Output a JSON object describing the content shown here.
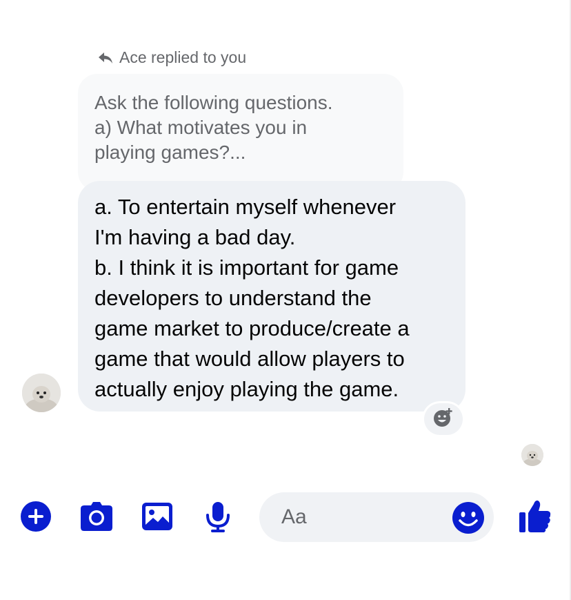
{
  "thread": {
    "reply_label": "Ace replied to you",
    "quoted_message": "Ask the following questions.\na) What motivates you in\nplaying games?...",
    "message": "a. To entertain myself whenever\nI'm having a bad day.\nb. I think it is important for game\ndevelopers to understand the\ngame market to produce/create a\ngame that would allow players to\nactually enjoy playing the game."
  },
  "composer": {
    "placeholder": "Aa",
    "value": "",
    "icons": [
      "plus-icon",
      "camera-icon",
      "image-icon",
      "microphone-icon",
      "emoji-icon",
      "thumbs-up-icon"
    ]
  },
  "colors": {
    "accent": "#0a1ecf",
    "bubble_main": "#eef1f5",
    "bubble_quoted": "#f8f9fa",
    "muted_text": "#65676b"
  }
}
